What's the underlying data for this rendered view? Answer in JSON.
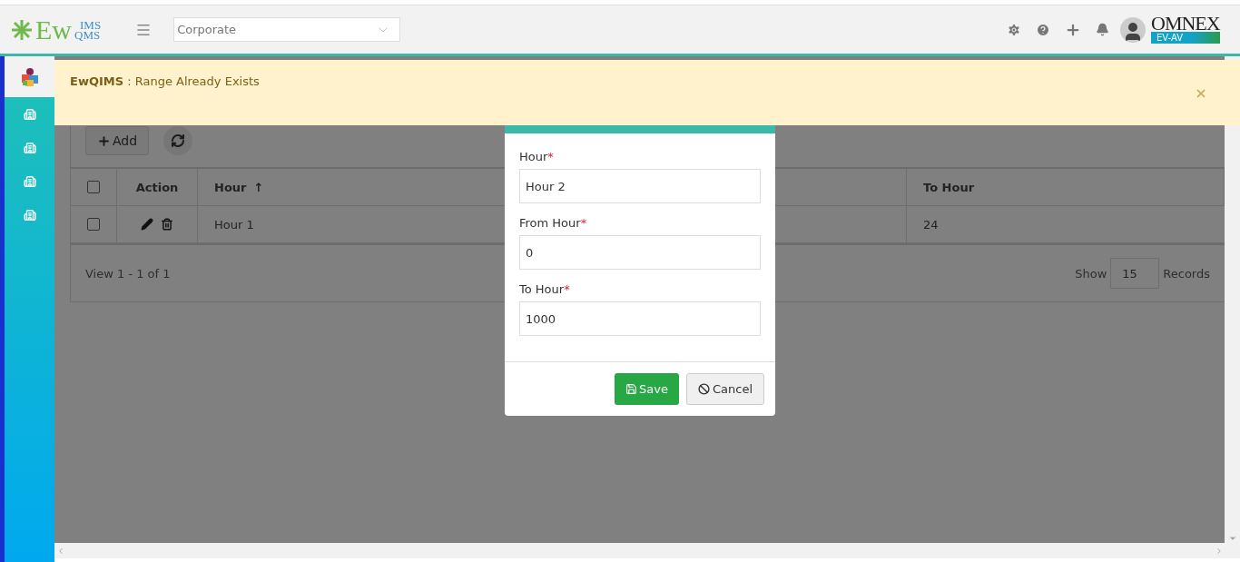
{
  "header": {
    "logo": {
      "main": "Ew",
      "top": "IMS",
      "bottom": "QMS"
    },
    "site_select": {
      "value": "Corporate"
    },
    "brand": {
      "name": "OMNEX",
      "tag": "EV-AV"
    }
  },
  "sidebar": {
    "items": [
      {
        "kind": "app",
        "selected": true
      },
      {
        "kind": "building",
        "selected": false
      },
      {
        "kind": "building",
        "selected": false
      },
      {
        "kind": "building",
        "selected": false
      },
      {
        "kind": "building",
        "selected": false
      }
    ]
  },
  "alert": {
    "message": "**EwQIMS** : Range Already Exists"
  },
  "toolbar": {
    "add_label": "Add"
  },
  "table": {
    "select_all_checked": false,
    "columns": [
      {
        "kind": "check"
      },
      {
        "kind": "actions",
        "label": "Action"
      },
      {
        "kind": "text",
        "label": "Hour",
        "sort_mark": "↑"
      },
      {
        "kind": "text"
      },
      {
        "kind": "text",
        "label": "To Hour"
      }
    ],
    "rows": [
      {
        "checked": false,
        "cells": [
          "",
          "",
          "Hour 1",
          "",
          "24"
        ]
      }
    ]
  },
  "footer": {
    "view": "View 1 - 1 of 1",
    "show": "Show",
    "page_size": "15",
    "records": "Records"
  },
  "dialog": {
    "fields": [
      {
        "label": "Hour",
        "required_mark": "*",
        "value": "Hour 2"
      },
      {
        "label": "From Hour",
        "required_mark": "*",
        "value": "0"
      },
      {
        "label": "To Hour",
        "required_mark": "*",
        "value": "1000"
      }
    ],
    "save": "Save",
    "cancel": "Cancel"
  }
}
